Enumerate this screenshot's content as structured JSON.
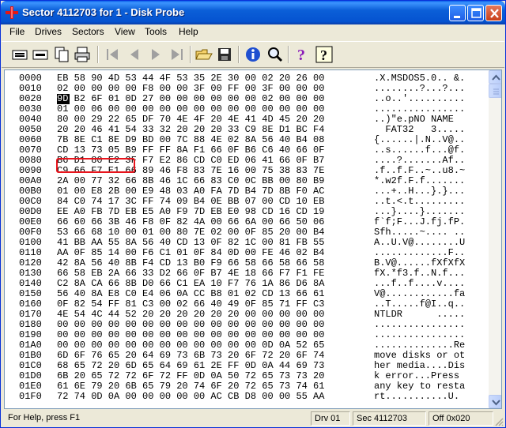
{
  "window": {
    "title": "Sector 4112703 for 1 - Disk Probe"
  },
  "menu": [
    "File",
    "Drives",
    "Sectors",
    "View",
    "Tools",
    "Help"
  ],
  "toolbar": {
    "icons": [
      "read-sector-icon",
      "write-sector-icon",
      "copy-icon",
      "print-icon",
      "first-sector-icon",
      "previous-sector-icon",
      "next-sector-icon",
      "last-sector-icon",
      "open-file-icon",
      "save-icon",
      "info-icon",
      "find-icon",
      "help-icon",
      "context-help-icon"
    ]
  },
  "hex_rows": [
    {
      "offset": "0000",
      "bytes": "EB 58 90 4D 53 44 4F 53 35 2E 30 00 02 20 26 00",
      "ascii": ".X.MSDOS5.0.. &."
    },
    {
      "offset": "0010",
      "bytes": "02 00 00 00 00 F8 00 00 3F 00 FF 00 3F 00 00 00",
      "ascii": "........?...?..."
    },
    {
      "offset": "0020",
      "bytes": "9D B2 6F 01 0D 27 00 00 00 00 00 00 02 00 00 00",
      "ascii": "..o..'.........."
    },
    {
      "offset": "0030",
      "bytes": "01 00 06 00 00 00 00 00 00 00 00 00 00 00 00 00",
      "ascii": "................"
    },
    {
      "offset": "0040",
      "bytes": "80 00 29 22 65 DF 70 4E 4F 20 4E 41 4D 45 20 20",
      "ascii": "..)\"e.pNO NAME  "
    },
    {
      "offset": "0050",
      "bytes": "20 20 46 41 54 33 32 20 20 20 33 C9 8E D1 BC F4",
      "ascii": "  FAT32   3....."
    },
    {
      "offset": "0060",
      "bytes": "7B 8E C1 8E D9 BD 00 7C 88 4E 02 8A 56 40 B4 08",
      "ascii": "{......|.N..V@.."
    },
    {
      "offset": "0070",
      "bytes": "CD 13 73 05 B9 FF FF 8A F1 66 0F B6 C6 40 66 0F",
      "ascii": "..s......f...@f."
    },
    {
      "offset": "0080",
      "bytes": "B6 D1 80 E2 3F F7 E2 86 CD C0 ED 06 41 66 0F B7",
      "ascii": "....?.......Af.."
    },
    {
      "offset": "0090",
      "bytes": "C9 66 F7 E1 66 89 46 F8 83 7E 16 00 75 38 83 7E",
      "ascii": ".f..f.F..~..u8.~"
    },
    {
      "offset": "00A0",
      "bytes": "2A 00 77 32 66 8B 46 1C 66 83 C0 0C BB 00 80 B9",
      "ascii": "*.w2f.F.f......."
    },
    {
      "offset": "00B0",
      "bytes": "01 00 E8 2B 00 E9 48 03 A0 FA 7D B4 7D 8B F0 AC",
      "ascii": "...+..H...}.}..."
    },
    {
      "offset": "00C0",
      "bytes": "84 C0 74 17 3C FF 74 09 B4 0E BB 07 00 CD 10 EB",
      "ascii": "..t.<.t........."
    },
    {
      "offset": "00D0",
      "bytes": "EE A0 FB 7D EB E5 A0 F9 7D EB E0 98 CD 16 CD 19",
      "ascii": "...}....}......."
    },
    {
      "offset": "00E0",
      "bytes": "66 60 66 3B 46 F8 0F 82 4A 00 66 6A 00 66 50 06",
      "ascii": "f`f;F...J.fj.fP."
    },
    {
      "offset": "00F0",
      "bytes": "53 66 68 10 00 01 00 80 7E 02 00 0F 85 20 00 B4",
      "ascii": "Sfh.....~.... .."
    },
    {
      "offset": "0100",
      "bytes": "41 BB AA 55 8A 56 40 CD 13 0F 82 1C 00 81 FB 55",
      "ascii": "A..U.V@........U"
    },
    {
      "offset": "0110",
      "bytes": "AA 0F 85 14 00 F6 C1 01 0F 84 0D 00 FE 46 02 B4",
      "ascii": ".............F.."
    },
    {
      "offset": "0120",
      "bytes": "42 8A 56 40 8B F4 CD 13 B0 F9 66 58 66 58 66 58",
      "ascii": "B.V@......fXfXfX"
    },
    {
      "offset": "0130",
      "bytes": "66 58 EB 2A 66 33 D2 66 0F B7 4E 18 66 F7 F1 FE",
      "ascii": "fX.*f3.f..N.f..."
    },
    {
      "offset": "0140",
      "bytes": "C2 8A CA 66 8B D0 66 C1 EA 10 F7 76 1A 86 D6 8A",
      "ascii": "...f..f....v...."
    },
    {
      "offset": "0150",
      "bytes": "56 40 8A E8 C0 E4 06 0A CC B8 01 02 CD 13 66 61",
      "ascii": "V@............fa"
    },
    {
      "offset": "0160",
      "bytes": "0F 82 54 FF 81 C3 00 02 66 40 49 0F 85 71 FF C3",
      "ascii": "..T.....f@I..q.."
    },
    {
      "offset": "0170",
      "bytes": "4E 54 4C 44 52 20 20 20 20 20 20 00 00 00 00 00",
      "ascii": "NTLDR      ....."
    },
    {
      "offset": "0180",
      "bytes": "00 00 00 00 00 00 00 00 00 00 00 00 00 00 00 00",
      "ascii": "................"
    },
    {
      "offset": "0190",
      "bytes": "00 00 00 00 00 00 00 00 00 00 00 00 00 00 00 00",
      "ascii": "................"
    },
    {
      "offset": "01A0",
      "bytes": "00 00 00 00 00 00 00 00 00 00 00 00 0D 0A 52 65",
      "ascii": "..............Re"
    },
    {
      "offset": "01B0",
      "bytes": "6D 6F 76 65 20 64 69 73 6B 73 20 6F 72 20 6F 74",
      "ascii": "move disks or ot"
    },
    {
      "offset": "01C0",
      "bytes": "68 65 72 20 6D 65 64 69 61 2E FF 0D 0A 44 69 73",
      "ascii": "her media....Dis"
    },
    {
      "offset": "01D0",
      "bytes": "6B 20 65 72 72 6F 72 FF 0D 0A 50 72 65 73 73 20",
      "ascii": "k error...Press "
    },
    {
      "offset": "01E0",
      "bytes": "61 6E 79 20 6B 65 79 20 74 6F 20 72 65 73 74 61",
      "ascii": "any key to resta"
    },
    {
      "offset": "01F0",
      "bytes": "72 74 0D 0A 00 00 00 00 00 AC CB D8 00 00 55 AA",
      "ascii": "rt...........U."
    }
  ],
  "status": {
    "help": "For Help, press F1",
    "drive": "Drv  01",
    "sector": "Sec 4112703",
    "offset": "Off 0x020"
  },
  "colors": {
    "title_bar": "#0553d0",
    "highlight": "#e8141c",
    "selection": "#000000"
  }
}
